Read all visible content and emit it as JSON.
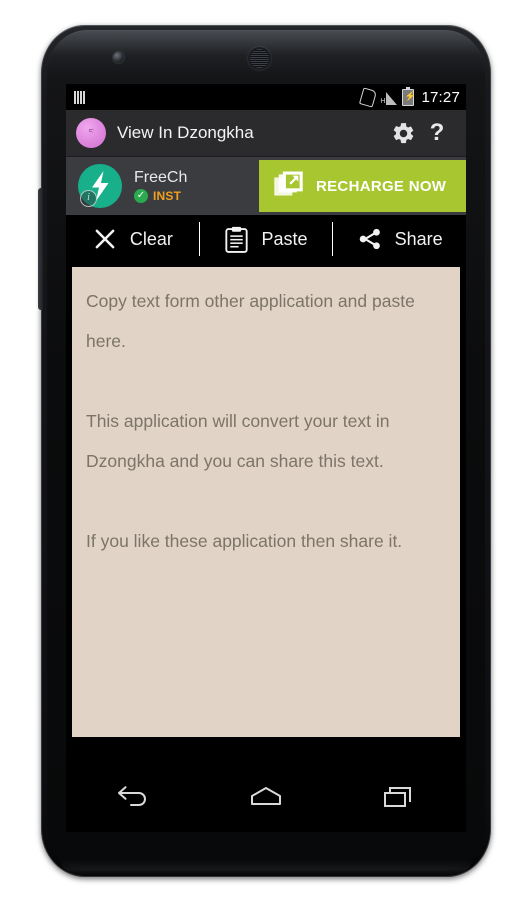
{
  "device": {
    "front_camera": "front-camera",
    "earpiece": "earpiece-speaker",
    "side_button": "volume-rocker"
  },
  "status_bar": {
    "signal_icon": "signal-bars-icon",
    "sim_icon": "sim-card-icon",
    "network_type": "H",
    "network_signal_icon": "network-signal-icon",
    "battery_icon": "battery-charging-icon",
    "battery_bolt": "⚡",
    "time": "17:27"
  },
  "action_bar": {
    "app_icon": "app-logo-icon",
    "app_icon_text": "ང་",
    "title": "View In Dzongkha",
    "settings_icon": "gear-icon",
    "help_icon": "help-question-icon",
    "help_glyph": "?"
  },
  "ad_banner": {
    "logo_icon": "freecharge-logo-icon",
    "info_icon": "ad-info-icon",
    "info_glyph": "i",
    "app_name": "FreeCh",
    "check_icon": "verified-check-icon",
    "check_glyph": "✓",
    "installs_label": "INST",
    "cta_icon": "external-link-icon",
    "cta_label": "RECHARGE NOW",
    "cta_color": "#a8c62f"
  },
  "toolbar": {
    "clear_icon": "close-x-icon",
    "clear_label": "Clear",
    "paste_icon": "clipboard-paste-icon",
    "paste_label": "Paste",
    "share_icon": "share-nodes-icon",
    "share_label": "Share"
  },
  "text_area": {
    "background_color": "#e2d3c7",
    "text_color": "#7c7468",
    "paragraphs": [
      "Copy text form other application and paste here.",
      "This application will convert your text in Dzongkha and you can share this text.",
      "If you like these application then share it."
    ]
  },
  "nav_bar": {
    "back_icon": "back-arrow-icon",
    "home_icon": "home-icon",
    "recents_icon": "recent-apps-icon"
  }
}
